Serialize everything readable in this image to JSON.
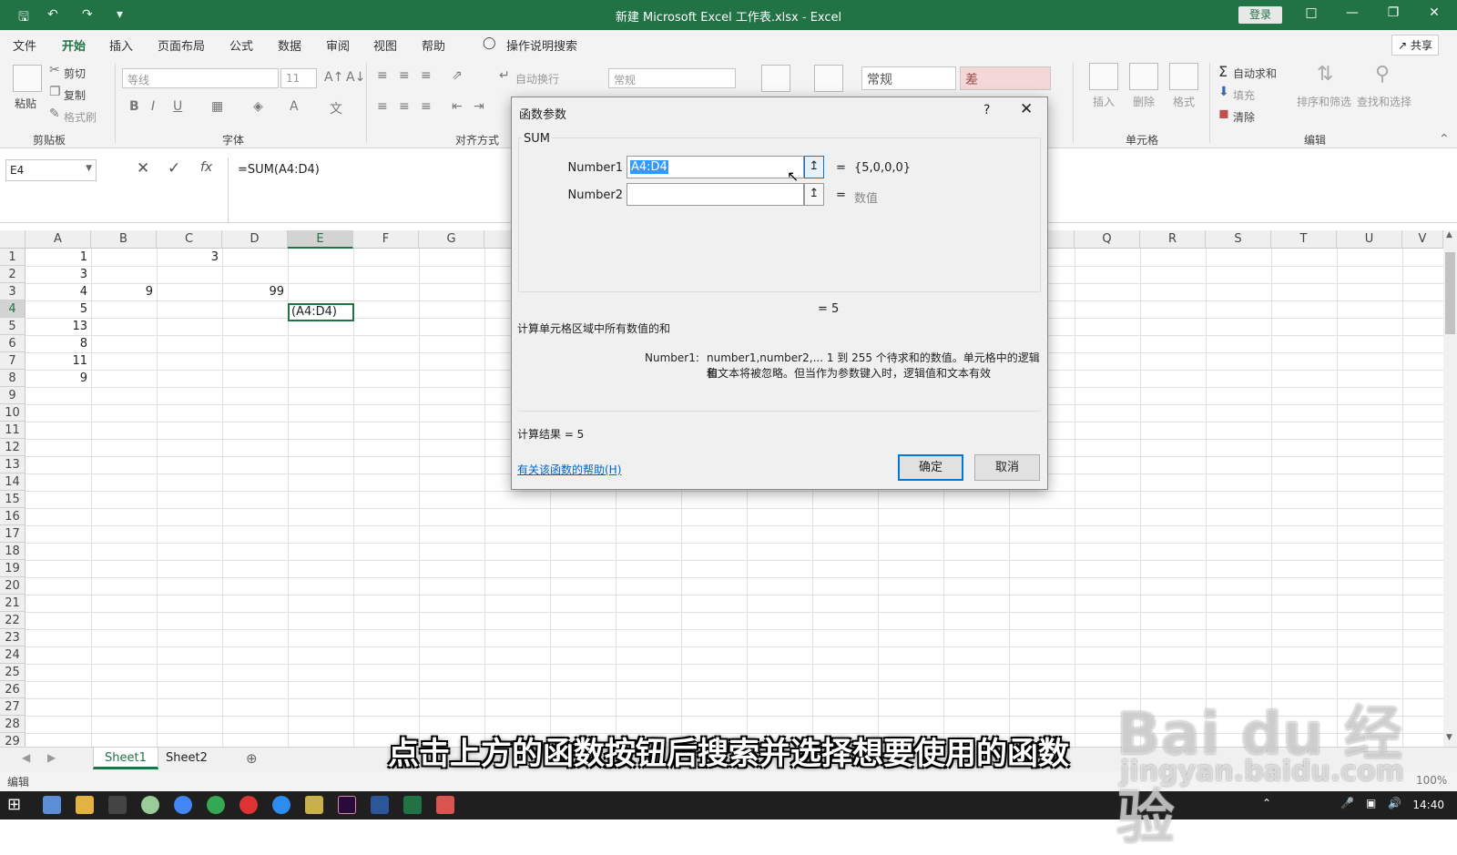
{
  "titlebar": {
    "title": "新建 Microsoft Excel 工作表.xlsx - Excel",
    "login": "登录",
    "save_icon": "save-icon",
    "undo_icon": "undo-icon",
    "redo_icon": "redo-icon",
    "accent": "#217346"
  },
  "menu": {
    "items": [
      "文件",
      "开始",
      "插入",
      "页面布局",
      "公式",
      "数据",
      "审阅",
      "视图",
      "帮助",
      "操作说明搜索"
    ],
    "active": "开始",
    "share": "共享"
  },
  "ribbon": {
    "paste": "粘贴",
    "cut": "剪切",
    "copy": "复制",
    "format_painter": "格式刷",
    "clipboard_group": "剪贴板",
    "font_name": "等线",
    "font_size": "11",
    "font_group": "字体",
    "wrap_text": "自动换行",
    "align_group": "对齐方式",
    "number_format": "常规",
    "style_normal": "常规",
    "style_bad": "差",
    "insert": "插入",
    "delete": "删除",
    "format": "格式",
    "cells_group": "单元格",
    "autosum": "自动求和",
    "fill": "填充",
    "clear": "清除",
    "sort_filter": "排序和筛选",
    "find_select": "查找和选择",
    "edit_group": "编辑"
  },
  "formula_bar": {
    "name_box": "E4",
    "formula": "=SUM(A4:D4)"
  },
  "grid": {
    "columns": [
      "A",
      "B",
      "C",
      "D",
      "E",
      "F",
      "G",
      "Q",
      "R",
      "S",
      "T",
      "U",
      "V"
    ],
    "rows": [
      "1",
      "2",
      "3",
      "4",
      "5",
      "6",
      "7",
      "8",
      "9",
      "10",
      "11",
      "12",
      "13",
      "14",
      "15",
      "16",
      "17",
      "18",
      "19",
      "20",
      "21",
      "22",
      "23",
      "24",
      "25",
      "26",
      "27",
      "28",
      "29"
    ],
    "col_a": [
      "1",
      "3",
      "4",
      "5",
      "13",
      "8",
      "11",
      "9"
    ],
    "b3": "9",
    "c1": "3",
    "d3": "99",
    "e4": "(A4:D4)"
  },
  "dialog": {
    "title": "函数参数",
    "help_q": "?",
    "function": "SUM",
    "arg1_label": "Number1",
    "arg1_value": "A4:D4",
    "arg1_result": "{5,0,0,0}",
    "arg2_label": "Number2",
    "arg2_result": "数值",
    "eq": "=",
    "preview": "= 5",
    "description": "计算单元格区域中所有数值的和",
    "arg_help_label": "Number1:",
    "arg_help_line1": "number1,number2,... 1 到 255 个待求和的数值。单元格中的逻辑值",
    "arg_help_line2": "和文本将被忽略。但当作为参数键入时，逻辑值和文本有效",
    "calc_result": "计算结果 =  5",
    "help_link": "有关该函数的帮助(H)",
    "ok": "确定",
    "cancel": "取消"
  },
  "sheets": {
    "tabs": [
      "Sheet1",
      "Sheet2"
    ],
    "active": "Sheet1"
  },
  "status": {
    "mode": "编辑",
    "zoom": "100%"
  },
  "taskbar": {
    "time": "14:40"
  },
  "overlay": {
    "subtitle": "点击上方的函数按钮后搜索并选择想要使用的函数",
    "watermark": "Bai du 经验",
    "watermark_url": "jingyan.baidu.com"
  }
}
